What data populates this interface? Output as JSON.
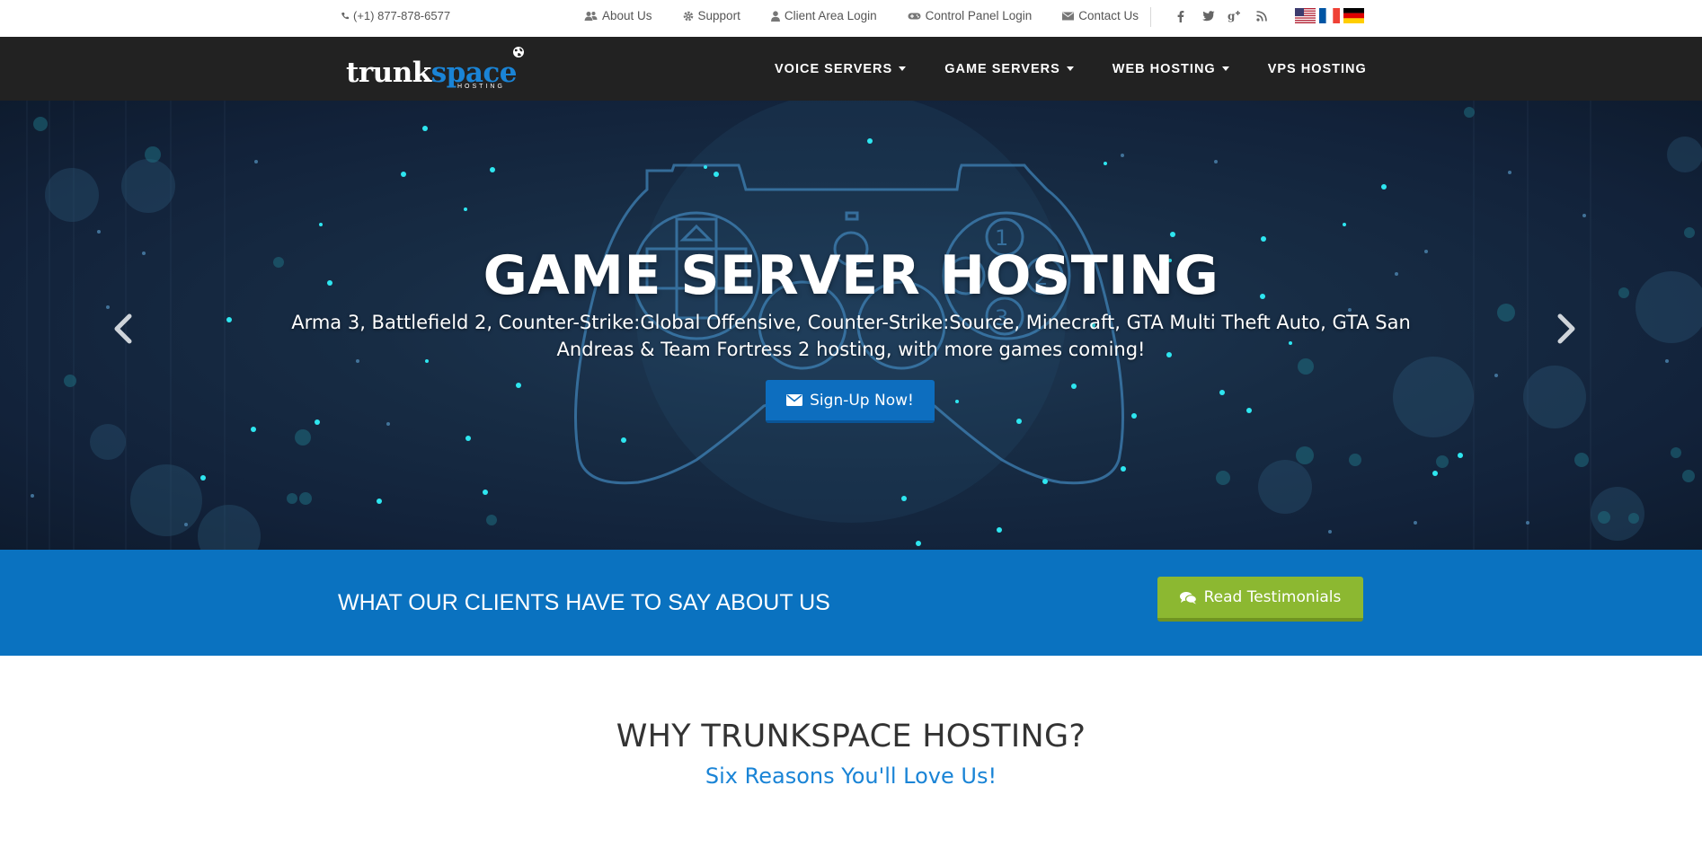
{
  "topbar": {
    "phone": "(+1) 877-878-6577",
    "links": [
      {
        "label": "About Us",
        "icon": "users-icon"
      },
      {
        "label": "Support",
        "icon": "gear-icon"
      },
      {
        "label": "Client Area Login",
        "icon": "user-icon"
      },
      {
        "label": "Control Panel Login",
        "icon": "gamepad-icon"
      },
      {
        "label": "Contact Us",
        "icon": "envelope-icon"
      }
    ],
    "social": [
      "facebook-icon",
      "twitter-icon",
      "google-plus-icon",
      "rss-icon"
    ],
    "flags": [
      "us-flag-icon",
      "france-flag-icon",
      "germany-flag-icon"
    ]
  },
  "navbar": {
    "logo_main": "trunk",
    "logo_accent": "space",
    "logo_sub": "HOSTING",
    "items": [
      {
        "label": "VOICE SERVERS",
        "dropdown": true
      },
      {
        "label": "GAME SERVERS",
        "dropdown": true
      },
      {
        "label": "WEB HOSTING",
        "dropdown": true
      },
      {
        "label": "VPS HOSTING",
        "dropdown": false
      }
    ]
  },
  "hero": {
    "title": "GAME SERVER HOSTING",
    "subtitle": "Arma 3, Battlefield 2, Counter-Strike:Global Offensive, Counter-Strike:Source, Minecraft, GTA Multi Theft Auto, GTA San Andreas & Team Fortress 2 hosting, with more games coming!",
    "button_label": "Sign-Up Now!"
  },
  "testimonials": {
    "heading": "WHAT OUR CLIENTS HAVE TO SAY ABOUT US",
    "button_label": "Read Testimonials"
  },
  "why": {
    "title": "WHY TRUNKSPACE HOSTING?",
    "subtitle": "Six Reasons You'll Love Us!"
  },
  "colors": {
    "navbar_bg": "#222222",
    "accent_blue": "#0a72c0",
    "logo_blue": "#1a84d6",
    "button_green": "#8cb831",
    "hero_dot": "#2ee6f0"
  }
}
